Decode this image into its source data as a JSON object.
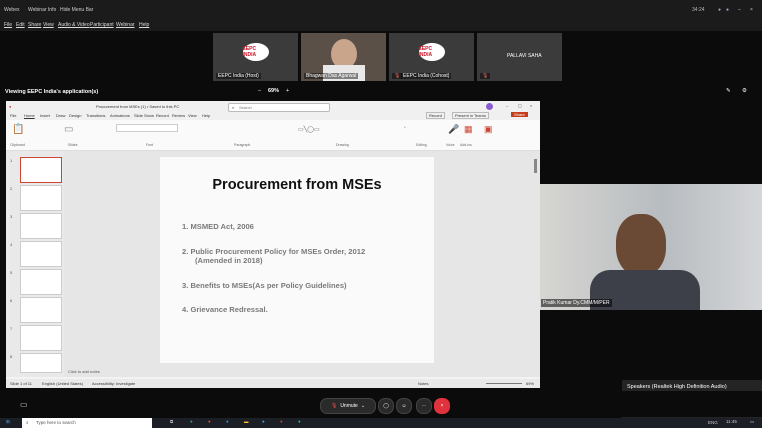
{
  "titlebar": {
    "app": "Webex",
    "item1": "Webinar Info",
    "item2": "Hide Menu Bar",
    "time": "34:24"
  },
  "menubar": [
    "File",
    "Edit",
    "Share",
    "View",
    "Audio & Video",
    "Participant",
    "Webinar",
    "Help"
  ],
  "participants": [
    {
      "name": "EEPC India (Host)",
      "logo": "EEPC INDIA"
    },
    {
      "name": "Bhagwan Das Agarwal"
    },
    {
      "name": "EEPC India (Cohost)",
      "logo": "EEPC INDIA"
    },
    {
      "name": "PALLAVI SAHA"
    }
  ],
  "viewing": {
    "label": "Viewing EEPC India's application(s)",
    "zoom": "69%"
  },
  "powerpoint": {
    "filename": "Procurement from MSEs (1) • Saved to this PC",
    "search_placeholder": "Search",
    "menu": [
      "File",
      "Home",
      "Insert",
      "Draw",
      "Design",
      "Transitions",
      "Animations",
      "Slide Show",
      "Record",
      "Review",
      "View",
      "Help"
    ],
    "record_btn": "Record",
    "present_btn": "Present in Teams",
    "share_btn": "Share",
    "ribbon_groups": [
      "Clipboard",
      "Slides",
      "Font",
      "Paragraph",
      "Drawing",
      "Editing",
      "Voice",
      "Add-ins"
    ],
    "notes_placeholder": "Click to add notes",
    "status_slide": "Slide 1 of 11",
    "status_lang": "English (United States)",
    "status_access": "Accessibility: Investigate",
    "status_notes": "Notes",
    "status_zoom": "69%"
  },
  "slide": {
    "title": "Procurement from MSEs",
    "items": [
      "1.  MSMED Act, 2006",
      "2.  Public Procurement Policy for MSEs Order, 2012",
      "(Amended in 2018)",
      "3.  Benefits to MSEs(As per Policy Guidelines)",
      "4.  Grievance Redressal."
    ]
  },
  "thumb_numbers": [
    "1",
    "2",
    "3",
    "4",
    "5",
    "6",
    "7",
    "8"
  ],
  "video": {
    "label": "Pratik Kumar Dy.CMM/M/PER"
  },
  "speakers": {
    "title": "Speakers (Realtek High Definition Audio)",
    "volume": "48",
    "level": 0.48
  },
  "controls": {
    "unmute": "Unmute"
  },
  "taskbar": {
    "search_placeholder": "Type here to search",
    "lang": "ENG",
    "time": "11:45"
  }
}
